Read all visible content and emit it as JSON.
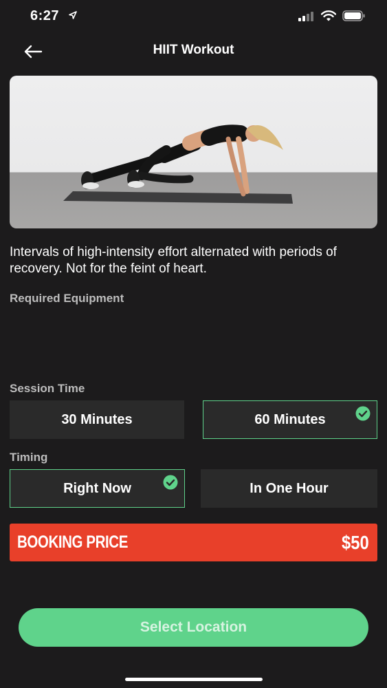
{
  "status_bar": {
    "time": "6:27",
    "location_icon": "location-arrow-icon",
    "signal_icon": "cellular-signal-icon",
    "wifi_icon": "wifi-icon",
    "battery_icon": "battery-icon"
  },
  "nav": {
    "title": "HIIT Workout",
    "back_icon": "arrow-left-icon"
  },
  "hero_image": "woman doing mountain climbers on a mat",
  "description": "Intervals of high-intensity effort alternated with periods of recovery. Not for the feint of heart.",
  "required_equipment": {
    "label": "Required Equipment"
  },
  "session_time": {
    "label": "Session Time",
    "options": [
      {
        "label": "30 Minutes",
        "selected": false
      },
      {
        "label": "60 Minutes",
        "selected": true
      }
    ]
  },
  "timing": {
    "label": "Timing",
    "options": [
      {
        "label": "Right Now",
        "selected": true
      },
      {
        "label": "In One Hour",
        "selected": false
      }
    ]
  },
  "booking": {
    "label": "BOOKING PRICE",
    "price": "$50"
  },
  "cta": {
    "label": "Select Location"
  },
  "colors": {
    "background": "#1c1b1c",
    "accent_green": "#5fd38b",
    "price_red": "#e8402a",
    "option_bg": "#2a2a2a"
  }
}
